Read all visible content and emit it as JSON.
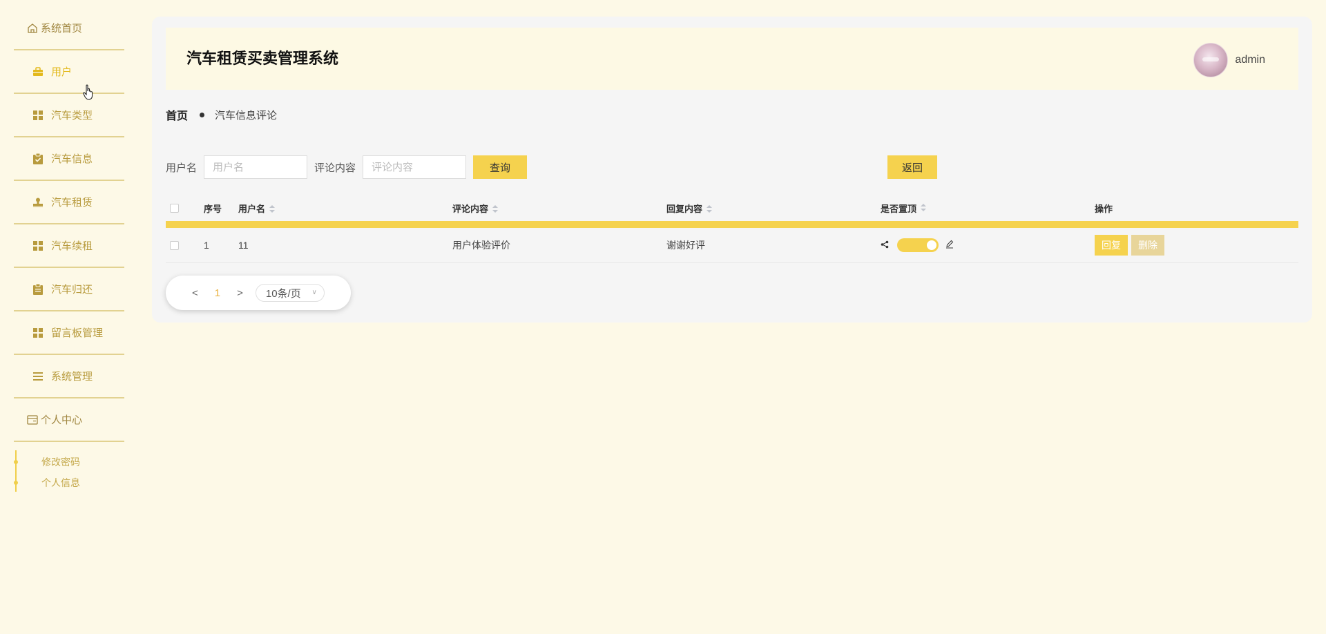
{
  "sidebar": {
    "home_label": "系统首页",
    "items": [
      {
        "label": "用户",
        "icon": "briefcase-icon",
        "active": true
      },
      {
        "label": "汽车类型",
        "icon": "grid-icon"
      },
      {
        "label": "汽车信息",
        "icon": "clipboard-check-icon"
      },
      {
        "label": "汽车租赁",
        "icon": "stamp-icon"
      },
      {
        "label": "汽车续租",
        "icon": "grid-icon"
      },
      {
        "label": "汽车归还",
        "icon": "clipboard-icon"
      },
      {
        "label": "留言板管理",
        "icon": "grid-icon"
      },
      {
        "label": "系统管理",
        "icon": "list-icon"
      }
    ],
    "personal_center": "个人中心",
    "sub_links": [
      "修改密码",
      "个人信息"
    ]
  },
  "header": {
    "title": "汽车租赁买卖管理系统",
    "username": "admin"
  },
  "breadcrumb": {
    "home": "首页",
    "current": "汽车信息评论"
  },
  "search": {
    "username_label": "用户名",
    "username_placeholder": "用户名",
    "comment_label": "评论内容",
    "comment_placeholder": "评论内容",
    "query_button": "查询",
    "back_button": "返回"
  },
  "table": {
    "headers": {
      "index": "序号",
      "username": "用户名",
      "comment": "评论内容",
      "reply": "回复内容",
      "pinned": "是否置顶",
      "ops": "操作"
    },
    "rows": [
      {
        "index": "1",
        "username": "11",
        "comment": "用户体验评价",
        "reply": "谢谢好评",
        "pinned": true,
        "reply_btn": "回复",
        "delete_btn": "删除"
      }
    ]
  },
  "pagination": {
    "prev": "<",
    "current": "1",
    "next": ">",
    "page_size": "10条/页"
  },
  "colors": {
    "accent": "#f5d24e",
    "background": "#fdf9e7",
    "sidebar_text": "#b89b3e"
  }
}
